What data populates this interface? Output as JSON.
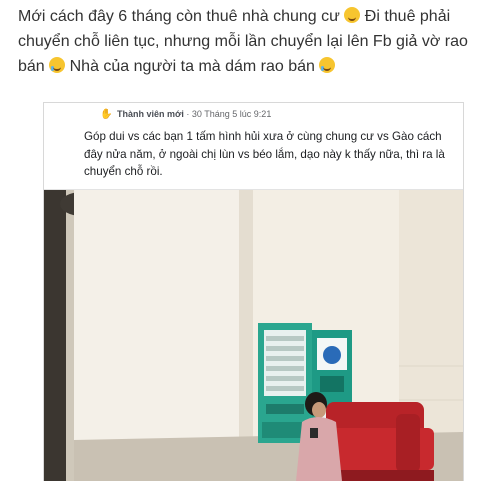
{
  "caption": {
    "part1": "Mới cách đây 6 tháng còn thuê nhà chung cư",
    "part2": "Đi thuê phải chuyển chỗ liên tục, nhưng mỗi lần chuyển lại lên Fb giả vờ rao bán",
    "part3": "Nhà của người ta mà dám rao bán",
    "icons": [
      "grin-emoji",
      "laughing-tears-emoji",
      "laughing-tears-emoji"
    ]
  },
  "post": {
    "member_label": "Thành viên mới",
    "separator": "·",
    "timestamp": "30 Tháng 5 lúc 9:21",
    "text": "Góp dui vs các bạn 1 tấm hình hủi xưa ở cùng chung cư vs Gào cách đây nửa năm, ở ngoài chị lùn vs béo lắm, dạo này k thấy nữa, thì ra là chuyển chỗ rồi."
  },
  "colors": {
    "caption_text": "#333333",
    "sofa": "#c8292e",
    "vending_machine": "#2aa68f",
    "wall": "#f1ede4"
  }
}
